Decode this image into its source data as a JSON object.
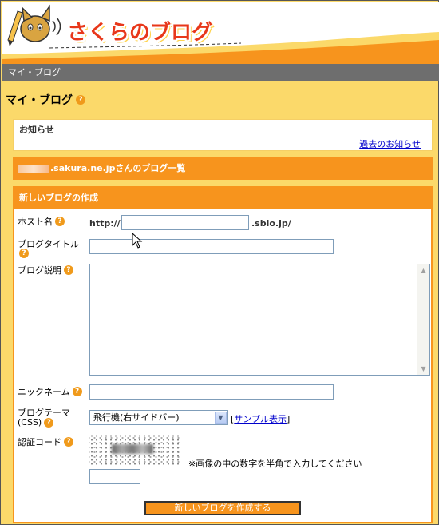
{
  "header": {
    "logo_text": "さくらのブログ",
    "mascot_icon": "cat-mascot-pencil-icon",
    "brand_color": "#e8371a"
  },
  "navbar": {
    "breadcrumb": "マイ・ブログ"
  },
  "page": {
    "title": "マイ・ブログ",
    "help_icon": "?"
  },
  "notice": {
    "title": "お知らせ",
    "link": "過去のお知らせ"
  },
  "blog_list": {
    "suffix": ".sakura.ne.jpさんのブログ一覧"
  },
  "create": {
    "header": "新しいブログの作成",
    "host_label": "ホスト名",
    "host_prefix": "http://",
    "host_value": "",
    "host_suffix": ".sblo.jp/",
    "title_label": "ブログタイトル",
    "title_value": "",
    "desc_label": "ブログ説明",
    "desc_value": "",
    "nickname_label": "ニックネーム",
    "nickname_value": "",
    "theme_label_1": "ブログテーマ",
    "theme_label_2": "(CSS)",
    "theme_selected": "飛行機(右サイドバー)",
    "sample_link": "サンプル表示",
    "captcha_label": "認証コード",
    "captcha_note": "※画像の中の数字を半角で入力してください",
    "captcha_value": "",
    "submit": "新しいブログを作成する"
  },
  "colors": {
    "accent_orange": "#f7941d",
    "background_yellow": "#fbd96a",
    "navbar_gray": "#6e6e6e",
    "link_blue": "#0000cc"
  }
}
